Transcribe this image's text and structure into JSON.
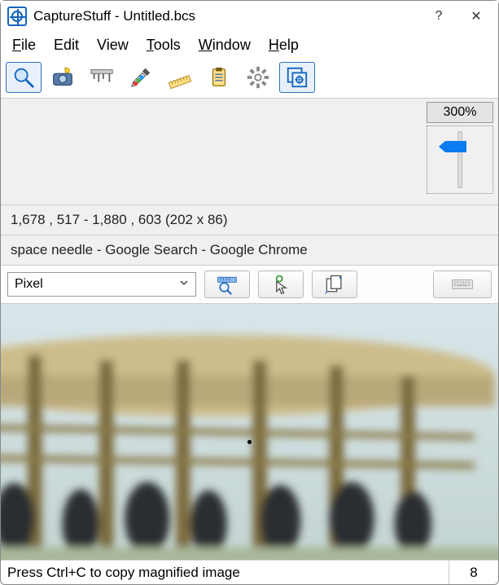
{
  "titlebar": {
    "app_name": "CaptureStuff",
    "document": "Untitled.bcs",
    "title": "CaptureStuff - Untitled.bcs",
    "help_glyph": "?",
    "close_glyph": "✕"
  },
  "menu": {
    "file": "File",
    "edit": "Edit",
    "view": "View",
    "tools": "Tools",
    "window": "Window",
    "help": "Help"
  },
  "toolbar": {
    "items": [
      {
        "name": "magnifier-tool",
        "selected": true
      },
      {
        "name": "camera-tool",
        "selected": false
      },
      {
        "name": "caliper-tool",
        "selected": false
      },
      {
        "name": "color-picker-tool",
        "selected": false
      },
      {
        "name": "ruler-tool",
        "selected": false
      },
      {
        "name": "clipboard-tool",
        "selected": false
      },
      {
        "name": "settings-tool",
        "selected": false
      },
      {
        "name": "overlay-tool",
        "selected": true
      }
    ]
  },
  "zoom": {
    "label": "300%",
    "value_percent": 300
  },
  "info": {
    "coords": "1,678 , 517 - 1,880 , 603 (202 x 86)",
    "window_title": "space needle - Google Search - Google Chrome"
  },
  "controls": {
    "unit_selected": "Pixel",
    "unit_options": [
      "Pixel"
    ],
    "buttons": [
      {
        "name": "measure-button"
      },
      {
        "name": "pointer-button"
      },
      {
        "name": "copy-button"
      }
    ],
    "keyboard_button": "keyboard-button"
  },
  "status": {
    "text": "Press Ctrl+C to copy magnified image",
    "value": "8"
  },
  "colors": {
    "accent": "#0a7cf0",
    "panel_bg": "#f0f0f0"
  }
}
